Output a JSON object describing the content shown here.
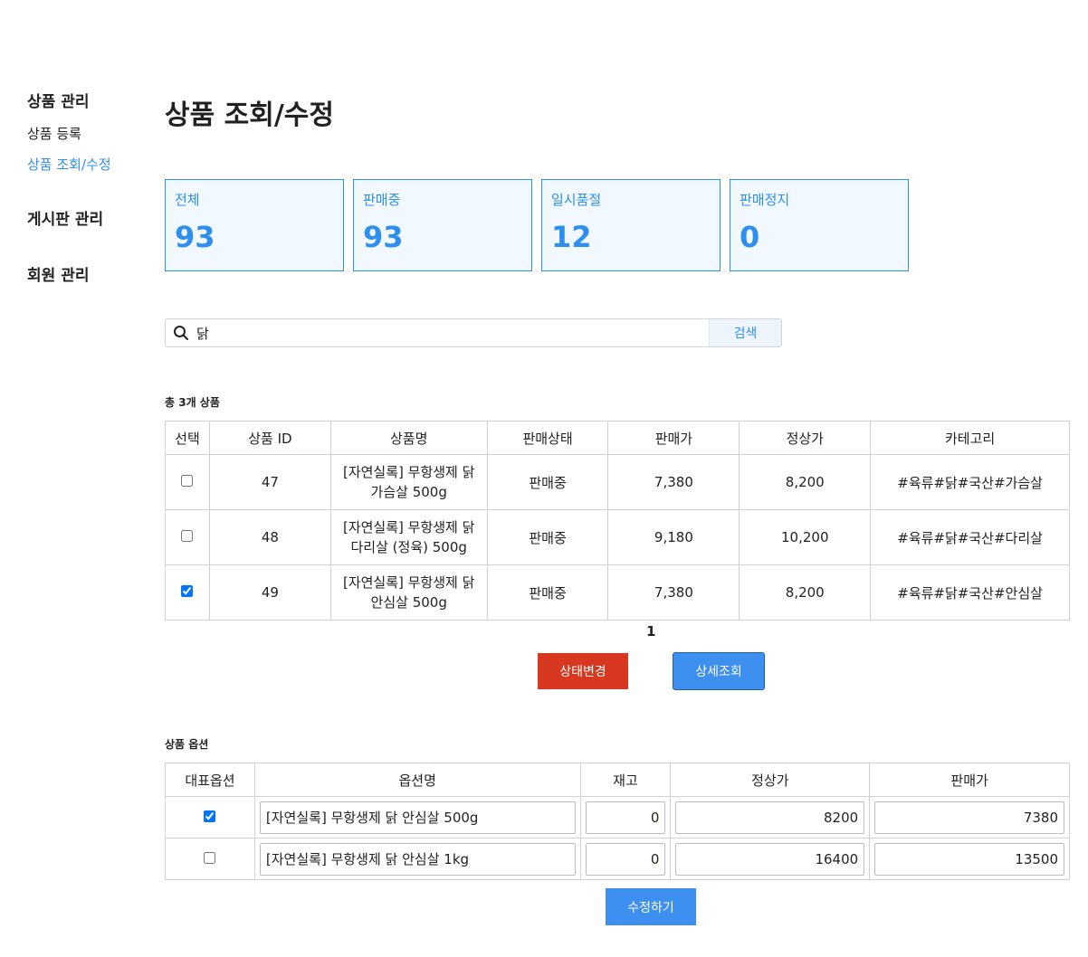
{
  "sidebar": {
    "sections": [
      {
        "title": "상품 관리",
        "items": [
          {
            "label": "상품 등록"
          },
          {
            "label": "상품 조회/수정",
            "active": true
          }
        ]
      },
      {
        "title": "게시판 관리",
        "items": []
      },
      {
        "title": "회원 관리",
        "items": []
      }
    ]
  },
  "page": {
    "title": "상품 조회/수정"
  },
  "stats": [
    {
      "label": "전체",
      "value": "93"
    },
    {
      "label": "판매중",
      "value": "93"
    },
    {
      "label": "일시품절",
      "value": "12"
    },
    {
      "label": "판매정지",
      "value": "0"
    }
  ],
  "search": {
    "value": "닭",
    "placeholder": "",
    "button_label": "검색",
    "icon": "search-icon"
  },
  "results": {
    "total_label": "총 3개 상품"
  },
  "product_table": {
    "headers": [
      "선택",
      "상품 ID",
      "상품명",
      "판매상태",
      "판매가",
      "정상가",
      "카테고리"
    ],
    "rows": [
      {
        "checked": false,
        "id": "47",
        "name": "[자연실록] 무항생제 닭 가슴살 500g",
        "status": "판매중",
        "sale_price": "7,380",
        "list_price": "8,200",
        "category": "#육류#닭#국산#가슴살"
      },
      {
        "checked": false,
        "id": "48",
        "name": "[자연실록] 무항생제 닭 다리살 (정육) 500g",
        "status": "판매중",
        "sale_price": "9,180",
        "list_price": "10,200",
        "category": "#육류#닭#국산#다리살"
      },
      {
        "checked": true,
        "id": "49",
        "name": "[자연실록] 무항생제 닭 안심살 500g",
        "status": "판매중",
        "sale_price": "7,380",
        "list_price": "8,200",
        "category": "#육류#닭#국산#안심살"
      }
    ]
  },
  "pagination": {
    "current": "1"
  },
  "actions": {
    "status_change_label": "상태변경",
    "detail_label": "상세조회",
    "status_color": "#d93820",
    "primary_color": "#3d8ff0"
  },
  "options": {
    "title": "상품 옵션",
    "headers": [
      "대표옵션",
      "옵션명",
      "재고",
      "정상가",
      "판매가"
    ],
    "rows": [
      {
        "primary": true,
        "name": "[자연실록] 무항생제 닭 안심살 500g",
        "stock": "0",
        "list_price": "8200",
        "sale_price": "7380"
      },
      {
        "primary": false,
        "name": "[자연실록] 무항생제 닭 안심살 1kg",
        "stock": "0",
        "list_price": "16400",
        "sale_price": "13500"
      }
    ],
    "save_label": "수정하기"
  },
  "colors": {
    "accent": "#2f8ff0",
    "card_bg": "#f2f8ff"
  }
}
